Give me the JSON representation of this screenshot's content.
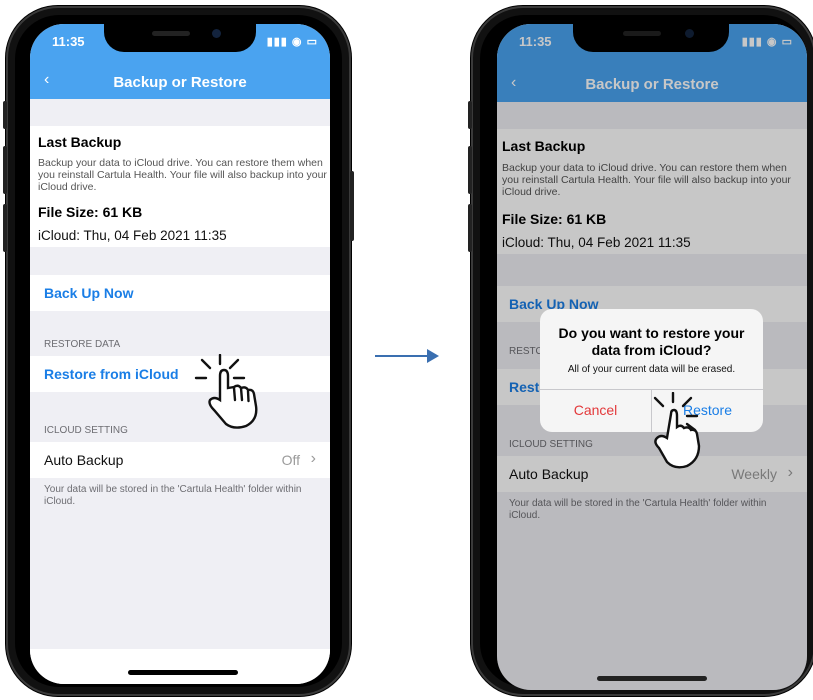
{
  "colors": {
    "nav": "#4aa3f0",
    "link": "#1a7ee6",
    "destructive": "#e3393b"
  },
  "status_bar": {
    "time": "11:35",
    "icons": "signal-wifi-battery"
  },
  "nav": {
    "back_icon": "chevron-left-icon",
    "title": "Backup or Restore"
  },
  "last_backup": {
    "heading": "Last Backup",
    "description": "Backup your data to iCloud drive. You can restore them when you reinstall Cartula Health. Your file will also backup into your iCloud drive.",
    "file_size": "File Size: 61 KB",
    "icloud_date": "iCloud: Thu, 04 Feb 2021 11:35"
  },
  "backup_now": "Back Up Now",
  "restore_section": {
    "header": "RESTORE DATA",
    "restore_link": "Restore from iCloud"
  },
  "icloud_section": {
    "header": "ICLOUD SETTING",
    "auto_backup_label": "Auto Backup",
    "auto_backup_value_before": "Off",
    "auto_backup_value_after": "Weekly",
    "chevron": "›",
    "footer": "Your data will be stored in the 'Cartula Health' folder within iCloud."
  },
  "dialog": {
    "title": "Do you want to restore your data from iCloud?",
    "message": "All of your current data will be erased.",
    "cancel": "Cancel",
    "restore": "Restore"
  },
  "left_restore_truncated": "Rest",
  "left_section_truncated": "RESTO",
  "annotations": {
    "arrow_icon": "right-arrow-icon",
    "tap_gesture_icon": "hand-tap-icon"
  }
}
